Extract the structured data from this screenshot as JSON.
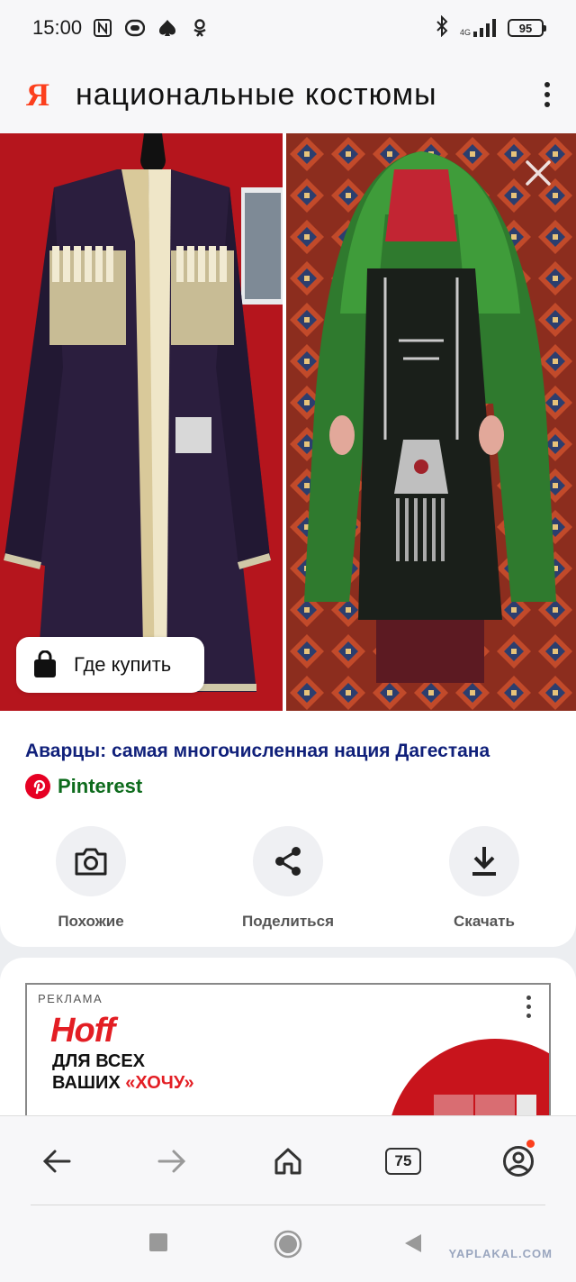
{
  "status_bar": {
    "time": "15:00",
    "network_label": "4G",
    "battery": "95"
  },
  "search": {
    "logo": "Я",
    "query": "национальные костюмы"
  },
  "image_viewer": {
    "buy_button_label": "Где купить"
  },
  "result": {
    "title": "Аварцы: самая многочисленная нация Дагестана",
    "source": "Pinterest",
    "actions": [
      {
        "label": "Похожие",
        "icon": "camera-search-icon"
      },
      {
        "label": "Поделиться",
        "icon": "share-icon"
      },
      {
        "label": "Скачать",
        "icon": "download-icon"
      }
    ]
  },
  "ad": {
    "label": "РЕКЛАМА",
    "brand": "Hoff",
    "line1": "ДЛЯ ВСЕХ",
    "line2_prefix": "ВАШИХ ",
    "line2_accent": "«ХОЧУ»"
  },
  "browser_bar": {
    "tabs_count": "75"
  },
  "watermark": "YAPLAKAL.COM",
  "colors": {
    "yandex_red": "#fc3f1d",
    "title_blue": "#10207a",
    "source_green": "#0d6b1c",
    "hoff_red": "#e31e24"
  }
}
